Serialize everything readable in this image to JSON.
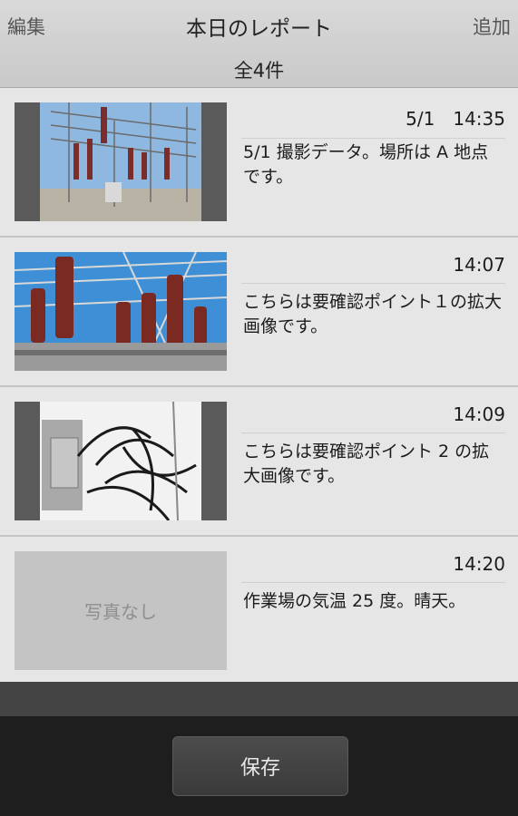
{
  "header": {
    "edit_label": "編集",
    "title": "本日のレポート",
    "add_label": "追加",
    "count": "全4件"
  },
  "reports": [
    {
      "time": "5/1　14:35",
      "note": "5/1 撮影データ。場所は A 地点です。",
      "photo": "substation-wide"
    },
    {
      "time": "14:07",
      "note": "こちらは要確認ポイント１の拡大画像です。",
      "photo": "insulators"
    },
    {
      "time": "14:09",
      "note": "こちらは要確認ポイント 2 の拡大画像です。",
      "photo": "cables"
    },
    {
      "time": "14:20",
      "note": "作業場の気温 25 度。晴天。",
      "photo": null,
      "no_photo_label": "写真なし"
    }
  ],
  "footer": {
    "save_label": "保存"
  }
}
